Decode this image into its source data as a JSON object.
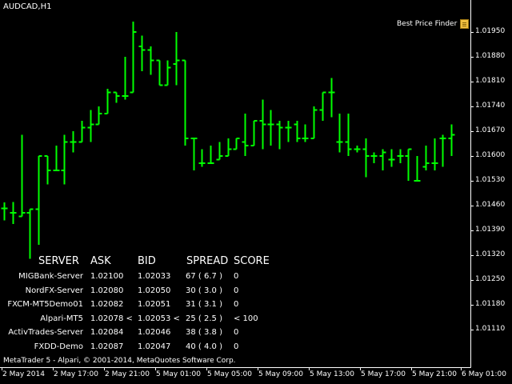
{
  "symbol": "AUDCAD,H1",
  "best_price_finder": "Best Price Finder",
  "copyright": "MetaTrader 5 - Alpari, © 2001-2014, MetaQuotes Software Corp.",
  "colors": {
    "background": "#000000",
    "bars": "#00ff00",
    "axis": "#ffffff",
    "text": "#ffffff"
  },
  "table": {
    "headers": [
      "SERVER",
      "ASK",
      "BID",
      "SPREAD",
      "SCORE"
    ],
    "rows": [
      [
        "MIGBank-Server",
        "1.02100",
        "1.02033",
        "67 ( 6.7 )",
        "0"
      ],
      [
        "NordFX-Server",
        "1.02080",
        "1.02050",
        "30 ( 3.0 )",
        "0"
      ],
      [
        "FXCM-MT5Demo01",
        "1.02082",
        "1.02051",
        "31 ( 3.1 )",
        "0"
      ],
      [
        "Alpari-MT5",
        "1.02078 <",
        "1.02053 <",
        "25 ( 2.5 )",
        "< 100"
      ],
      [
        "ActivTrades-Server",
        "1.02084",
        "1.02046",
        "38 ( 3.8 )",
        "0"
      ],
      [
        "FXDD-Demo",
        "1.02087",
        "1.02047",
        "40 ( 4.0 )",
        "0"
      ]
    ]
  },
  "chart_data": {
    "type": "ohlc",
    "symbol": "AUDCAD",
    "timeframe": "H1",
    "y_ticks": [
      "1.01950",
      "1.01880",
      "1.01810",
      "1.01740",
      "1.01670",
      "1.01600",
      "1.01530",
      "1.01460",
      "1.01390",
      "1.01320",
      "1.01250",
      "1.01180",
      "1.01110"
    ],
    "x_ticks": [
      "2 May 2014",
      "2 May 17:00",
      "2 May 21:00",
      "5 May 01:00",
      "5 May 05:00",
      "5 May 09:00",
      "5 May 13:00",
      "5 May 17:00",
      "5 May 21:00",
      "6 May 01:00"
    ],
    "ylim": [
      1.01065,
      1.02
    ],
    "bars": [
      {
        "o": 1.01452,
        "h": 1.01469,
        "l": 1.01418,
        "c": 1.01452
      },
      {
        "o": 1.0144,
        "h": 1.0147,
        "l": 1.01408,
        "c": 1.0144
      },
      {
        "o": 1.0143,
        "h": 1.0166,
        "l": 1.0143,
        "c": 1.0144
      },
      {
        "o": 1.0144,
        "h": 1.0144,
        "l": 1.0131,
        "c": 1.0145
      },
      {
        "o": 1.0145,
        "h": 1.0145,
        "l": 1.0135,
        "c": 1.016
      },
      {
        "o": 1.016,
        "h": 1.016,
        "l": 1.0152,
        "c": 1.0156
      },
      {
        "o": 1.0156,
        "h": 1.0163,
        "l": 1.0156,
        "c": 1.0156
      },
      {
        "o": 1.0156,
        "h": 1.0166,
        "l": 1.0152,
        "c": 1.0164
      },
      {
        "o": 1.0164,
        "h": 1.0167,
        "l": 1.0161,
        "c": 1.0164
      },
      {
        "o": 1.0164,
        "h": 1.017,
        "l": 1.0164,
        "c": 1.0168
      },
      {
        "o": 1.0168,
        "h": 1.0173,
        "l": 1.0164,
        "c": 1.0169
      },
      {
        "o": 1.0169,
        "h": 1.0174,
        "l": 1.017,
        "c": 1.0172
      },
      {
        "o": 1.0172,
        "h": 1.0179,
        "l": 1.0172,
        "c": 1.0178
      },
      {
        "o": 1.0178,
        "h": 1.0177,
        "l": 1.0175,
        "c": 1.0177
      },
      {
        "o": 1.0177,
        "h": 1.0188,
        "l": 1.0176,
        "c": 1.0177
      },
      {
        "o": 1.0178,
        "h": 1.0198,
        "l": 1.0192,
        "c": 1.0195
      },
      {
        "o": 1.0191,
        "h": 1.0194,
        "l": 1.0184,
        "c": 1.019
      },
      {
        "o": 1.019,
        "h": 1.0191,
        "l": 1.0183,
        "c": 1.0187
      },
      {
        "o": 1.0187,
        "h": 1.0187,
        "l": 1.018,
        "c": 1.018
      },
      {
        "o": 1.018,
        "h": 1.0187,
        "l": 1.018,
        "c": 1.0185
      },
      {
        "o": 1.0186,
        "h": 1.0195,
        "l": 1.018,
        "c": 1.0187
      },
      {
        "o": 1.0187,
        "h": 1.0187,
        "l": 1.0163,
        "c": 1.0165
      },
      {
        "o": 1.0165,
        "h": 1.0165,
        "l": 1.0156,
        "c": 1.0165
      },
      {
        "o": 1.0158,
        "h": 1.0162,
        "l": 1.0157,
        "c": 1.0158
      },
      {
        "o": 1.0158,
        "h": 1.0163,
        "l": 1.0158,
        "c": 1.0158
      },
      {
        "o": 1.0159,
        "h": 1.0164,
        "l": 1.0159,
        "c": 1.016
      },
      {
        "o": 1.016,
        "h": 1.0165,
        "l": 1.016,
        "c": 1.0162
      },
      {
        "o": 1.0162,
        "h": 1.0165,
        "l": 1.0162,
        "c": 1.0165
      },
      {
        "o": 1.0164,
        "h": 1.0172,
        "l": 1.016,
        "c": 1.0163
      },
      {
        "o": 1.0163,
        "h": 1.017,
        "l": 1.0163,
        "c": 1.017
      },
      {
        "o": 1.017,
        "h": 1.0176,
        "l": 1.0162,
        "c": 1.0169
      },
      {
        "o": 1.0169,
        "h": 1.0173,
        "l": 1.0163,
        "c": 1.0169
      },
      {
        "o": 1.0169,
        "h": 1.017,
        "l": 1.0162,
        "c": 1.0168
      },
      {
        "o": 1.0168,
        "h": 1.017,
        "l": 1.0164,
        "c": 1.0168
      },
      {
        "o": 1.0169,
        "h": 1.017,
        "l": 1.0164,
        "c": 1.0165
      },
      {
        "o": 1.0165,
        "h": 1.0169,
        "l": 1.0164,
        "c": 1.0165
      },
      {
        "o": 1.0165,
        "h": 1.0174,
        "l": 1.0165,
        "c": 1.0173
      },
      {
        "o": 1.0173,
        "h": 1.0178,
        "l": 1.017,
        "c": 1.0178
      },
      {
        "o": 1.0178,
        "h": 1.0182,
        "l": 1.0171,
        "c": 1.0178
      },
      {
        "o": 1.0164,
        "h": 1.0172,
        "l": 1.0161,
        "c": 1.0164
      },
      {
        "o": 1.0164,
        "h": 1.0172,
        "l": 1.016,
        "c": 1.0162
      },
      {
        "o": 1.0162,
        "h": 1.0163,
        "l": 1.0161,
        "c": 1.0162
      },
      {
        "o": 1.0162,
        "h": 1.0165,
        "l": 1.0154,
        "c": 1.016
      },
      {
        "o": 1.016,
        "h": 1.0161,
        "l": 1.0158,
        "c": 1.016
      },
      {
        "o": 1.016,
        "h": 1.0162,
        "l": 1.0156,
        "c": 1.0161
      },
      {
        "o": 1.0159,
        "h": 1.0162,
        "l": 1.0157,
        "c": 1.0159
      },
      {
        "o": 1.016,
        "h": 1.0162,
        "l": 1.0158,
        "c": 1.016
      },
      {
        "o": 1.016,
        "h": 1.0162,
        "l": 1.0153,
        "c": 1.0162
      },
      {
        "o": 1.0153,
        "h": 1.016,
        "l": 1.0153,
        "c": 1.0153
      },
      {
        "o": 1.0157,
        "h": 1.0163,
        "l": 1.0156,
        "c": 1.0158
      },
      {
        "o": 1.0158,
        "h": 1.0165,
        "l": 1.0156,
        "c": 1.0158
      },
      {
        "o": 1.0165,
        "h": 1.0166,
        "l": 1.0157,
        "c": 1.0165
      },
      {
        "o": 1.0165,
        "h": 1.0169,
        "l": 1.016,
        "c": 1.0166
      }
    ]
  }
}
